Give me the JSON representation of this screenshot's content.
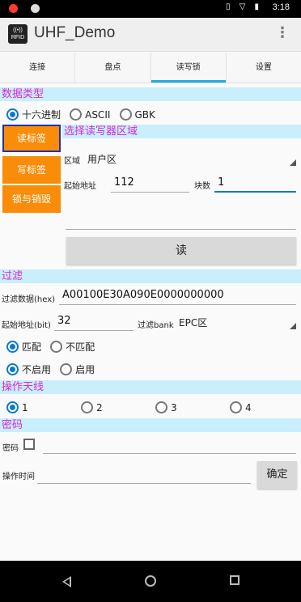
{
  "status_bar": {
    "time": "3:18"
  },
  "app_bar": {
    "title": "UHF_Demo",
    "logo_text": "RFID",
    "more_icon": "more-vert-icon"
  },
  "tabs": [
    {
      "label": "连接",
      "active": false
    },
    {
      "label": "盘点",
      "active": false
    },
    {
      "label": "读写锁",
      "active": true
    },
    {
      "label": "设置",
      "active": false
    }
  ],
  "data_type": {
    "title": "数据类型",
    "options": [
      "十六进制",
      "ASCII",
      "GBK"
    ],
    "selected": 0
  },
  "side_buttons": {
    "read": "读标签",
    "write": "写标签",
    "lock": "锁与销毁"
  },
  "area_section": {
    "title": "选择读写器区域",
    "area_label": "区域",
    "area_value": "用户区",
    "start_label": "起始地址",
    "start_value": "112",
    "count_label": "块数",
    "count_value": "1",
    "data_value": "",
    "read_button": "读"
  },
  "filter": {
    "title": "过滤",
    "data_label": "过滤数据(hex)",
    "data_value": "A00100E30A090E0000000000",
    "start_label": "起始地址(bit)",
    "start_value": "32",
    "bank_label": "过滤bank",
    "bank_value": "EPC区",
    "match_options": [
      "匹配",
      "不匹配"
    ],
    "match_selected": 0,
    "enable_options": [
      "不启用",
      "启用"
    ],
    "enable_selected": 0
  },
  "antenna": {
    "title": "操作天线",
    "options": [
      "1",
      "2",
      "3",
      "4"
    ],
    "selected": 0
  },
  "password": {
    "title": "密码",
    "label": "密码",
    "value": "",
    "time_label": "操作时间",
    "time_value": "",
    "confirm_button": "确定"
  },
  "colors": {
    "accent": "#29a8df",
    "section_bg": "#c9eefc",
    "section_text": "#d62ad6",
    "orange": "#f98c08",
    "radio": "#0b78d0"
  }
}
